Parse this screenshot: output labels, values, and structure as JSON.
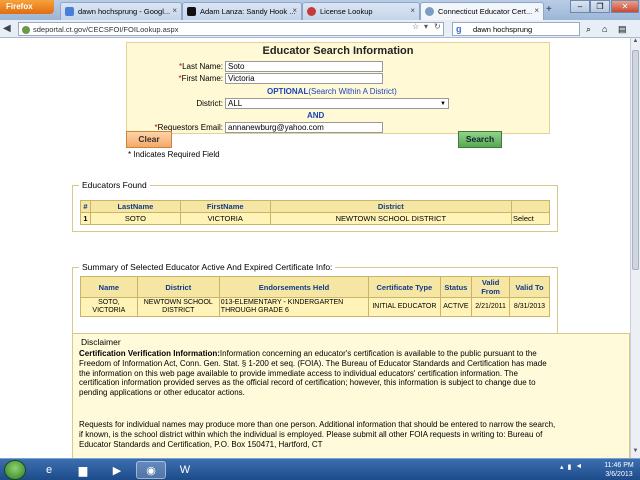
{
  "browser": {
    "app_button": "Firefox",
    "tabs": [
      {
        "label": "dawn hochsprung - Googl...",
        "active": false,
        "icon": "google-icon"
      },
      {
        "label": "Adam Lanza: Sandy Hook ...",
        "active": false,
        "icon": "nyt-icon"
      },
      {
        "label": "License Lookup",
        "active": false,
        "icon": "license-icon"
      },
      {
        "label": "Connecticut Educator Cert...",
        "active": true,
        "icon": "globe-icon"
      }
    ],
    "new_tab": "+",
    "url": "sdeportal.ct.gov/CECSFOI/FOILookup.aspx",
    "search_value": "dawn hochsprung",
    "search_engine_letter": "g"
  },
  "form": {
    "title": "Educator Search Information",
    "required_mark": "*",
    "last_name_label": "Last Name:",
    "last_name_value": "Soto",
    "first_name_label": "First Name:",
    "first_name_value": "Victoria",
    "optional_label": "OPTIONAL",
    "optional_hint": "(Search Within A District)",
    "district_label": "District:",
    "district_value": "ALL",
    "and_label": "AND",
    "requestor_email_label": "Requestors Email:",
    "requestor_email_value": "annanewburg@yahoo.com",
    "clear_button": "Clear",
    "search_button": "Search",
    "required_note": "* Indicates Required Field"
  },
  "educators_found": {
    "legend": "Educators Found",
    "columns": [
      "#",
      "LastName",
      "FirstName",
      "District",
      ""
    ],
    "rows": [
      {
        "num": "1",
        "last": "SOTO",
        "first": "VICTORIA",
        "district": "NEWTOWN SCHOOL DISTRICT",
        "action": "Select"
      }
    ]
  },
  "certificate_summary": {
    "legend": "Summary of Selected Educator Active And Expired Certificate Info:",
    "columns": [
      "Name",
      "District",
      "Endorsements Held",
      "Certificate Type",
      "Status",
      "Valid From",
      "Valid To"
    ],
    "rows": [
      {
        "name": "SOTO, VICTORIA",
        "district": "NEWTOWN SCHOOL DISTRICT",
        "endorsements": "013-ELEMENTARY - KINDERGARTEN THROUGH GRADE 6",
        "type": "INITIAL EDUCATOR",
        "status": "ACTIVE",
        "from": "2/21/2011",
        "to": "8/31/2013"
      }
    ]
  },
  "disclaimer": {
    "legend": "Disclaimer",
    "heading": "Certification Verification Information:",
    "para1": "Information concerning an educator's certification is available to the public pursuant to the Freedom of Information Act, Conn. Gen. Stat. § 1-200 et seq. (FOIA). The Bureau of Educator Standards and Certification has made the information on this web page available to provide immediate access to individual educators' certification information. The certification information provided serves as the official record of certification; however, this information is subject to change due to pending applications or other educator actions.",
    "para2": "Requests for individual names may produce more than one person. Additional information that should be entered to narrow the search, if known, is the school district within which the individual is employed. Please submit all other FOIA requests in writing to: Bureau of Educator Standards and Certification, P.O. Box 150471, Hartford, CT"
  },
  "taskbar": {
    "time": "11:46 PM",
    "date": "3/6/2013"
  }
}
